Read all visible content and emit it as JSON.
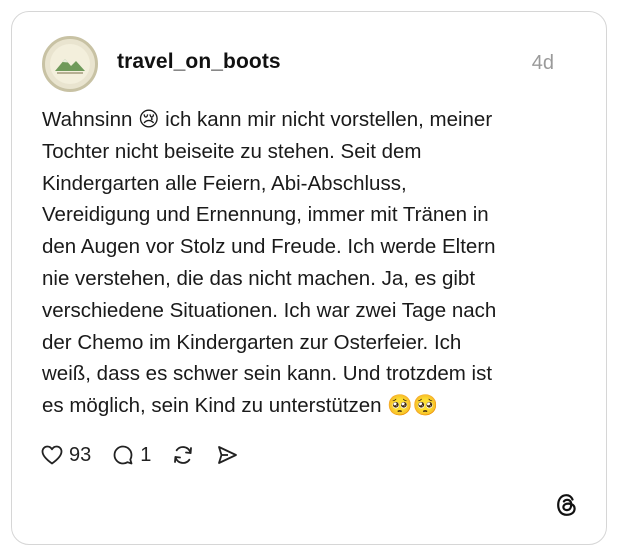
{
  "post": {
    "username": "travel_on_boots",
    "time_ago": "4d",
    "avatar_icon": "mountain-logo-icon",
    "text": "Wahnsinn 😢 ich kann mir nicht vorstellen, meiner\nTochter nicht beiseite zu stehen. Seit dem\nKindergarten alle Feiern, Abi-Abschluss,\nVereidigung und Ernennung, immer mit Tränen in\nden Augen vor Stolz und Freude. Ich werde Eltern\nnie verstehen, die das nicht machen. Ja, es gibt\nverschiedene Situationen. Ich war zwei Tage nach\nder Chemo im Kindergarten zur Osterfeier. Ich\nweiß, dass es schwer sein kann. Und trotzdem ist\nes möglich, sein Kind zu unterstützen 🥺🥺"
  },
  "actions": {
    "like_count": "93",
    "reply_count": "1",
    "like_icon": "heart-icon",
    "reply_icon": "comment-bubble-icon",
    "repost_icon": "repost-icon",
    "share_icon": "send-icon"
  },
  "branding": {
    "logo_icon": "threads-logo-icon"
  },
  "colors": {
    "text": "#1a1a1a",
    "muted": "#9a9a9a",
    "border": "#d6d6d6"
  }
}
